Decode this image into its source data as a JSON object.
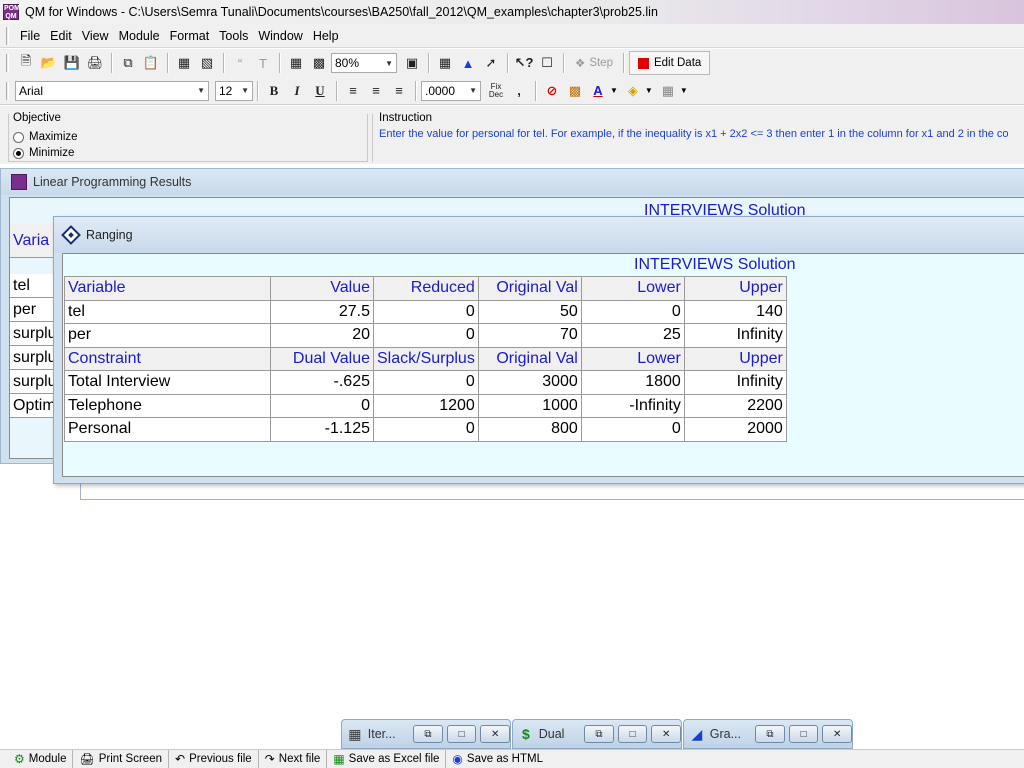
{
  "window": {
    "title": "QM for Windows - C:\\Users\\Semra Tunali\\Documents\\courses\\BA250\\fall_2012\\QM_examples\\chapter3\\prob25.lin",
    "icon_text": "POM QM"
  },
  "menu": [
    {
      "label": "File"
    },
    {
      "label": "Edit"
    },
    {
      "label": "View"
    },
    {
      "label": "Module"
    },
    {
      "label": "Format"
    },
    {
      "label": "Tools"
    },
    {
      "label": "Window"
    },
    {
      "label": "Help"
    }
  ],
  "toolbar1": {
    "zoom": "80%",
    "step_label": "Step",
    "edit_data_label": "Edit Data"
  },
  "toolbar2": {
    "font": "Arial",
    "font_size": "12",
    "number_format": ".0000",
    "fix_dec_label": "Fix\nDec"
  },
  "objective": {
    "legend": "Objective",
    "options": [
      {
        "label": "Maximize",
        "selected": false
      },
      {
        "label": "Minimize",
        "selected": true
      }
    ]
  },
  "instruction": {
    "legend": "Instruction",
    "text": "Enter the value for personal for tel. For example, if the inequality is x1 + 2x2 <= 3 then enter 1 in the column for x1 and 2 in the co"
  },
  "lp_results": {
    "title": "Linear Programming Results",
    "solution_title": "INTERVIEWS Solution",
    "visible_cells": [
      "Varia",
      "tel",
      "per",
      "surplu",
      "surplu",
      "surplu",
      "Optim"
    ]
  },
  "ranging": {
    "title": "Ranging",
    "solution_title": "INTERVIEWS Solution",
    "variable_header": [
      "Variable",
      "Value",
      "Reduced",
      "Original Val",
      "Lower",
      "Upper"
    ],
    "variable_rows": [
      [
        "tel",
        "27.5",
        "0",
        "50",
        "0",
        "140"
      ],
      [
        "per",
        "20",
        "0",
        "70",
        "25",
        "Infinity"
      ]
    ],
    "constraint_header": [
      "Constraint",
      "Dual Value",
      "Slack/Surplus",
      "Original Val",
      "Lower",
      "Upper"
    ],
    "constraint_rows": [
      [
        "Total Interview",
        "-.625",
        "0",
        "3000",
        "1800",
        "Infinity"
      ],
      [
        "Telephone",
        "0",
        "1200",
        "1000",
        "-Infinity",
        "2200"
      ],
      [
        "Personal",
        "-1.125",
        "0",
        "800",
        "0",
        "2000"
      ]
    ]
  },
  "minimized": [
    {
      "label": "Iter..."
    },
    {
      "label": "Dual"
    },
    {
      "label": "Gra..."
    }
  ],
  "bottombar": [
    {
      "label": "Module"
    },
    {
      "label": "Print Screen"
    },
    {
      "label": "Previous file"
    },
    {
      "label": "Next file"
    },
    {
      "label": "Save as Excel file"
    },
    {
      "label": "Save as HTML"
    }
  ]
}
